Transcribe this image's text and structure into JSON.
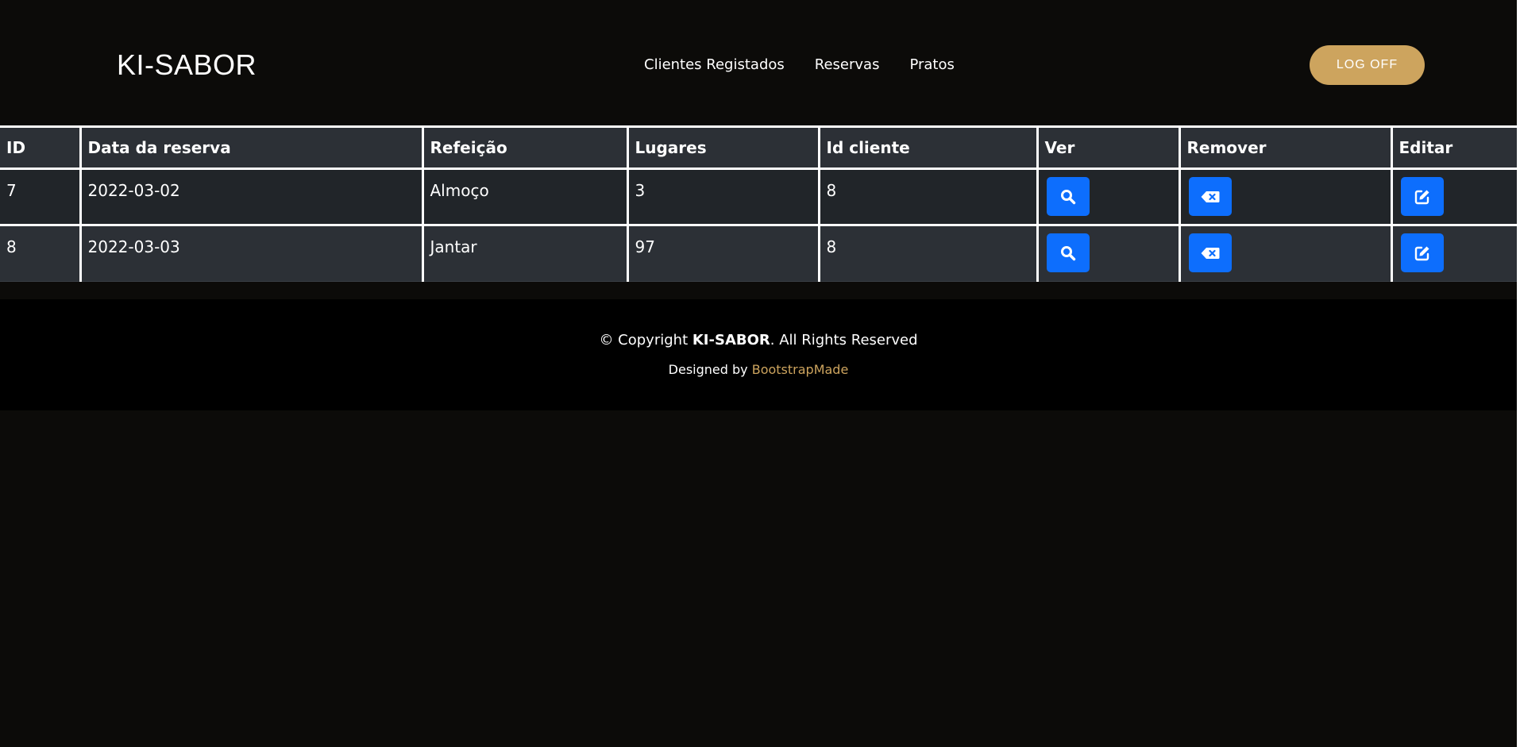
{
  "header": {
    "logo": "KI-SABOR",
    "nav": [
      "Clientes Registados",
      "Reservas",
      "Pratos"
    ],
    "logoff_label": "LOG OFF"
  },
  "table": {
    "columns": [
      "ID",
      "Data da reserva",
      "Refeição",
      "Lugares",
      "Id cliente",
      "Ver",
      "Remover",
      "Editar"
    ],
    "rows": [
      {
        "id": "7",
        "date": "2022-03-02",
        "meal": "Almoço",
        "seats": "3",
        "client": "8"
      },
      {
        "id": "8",
        "date": "2022-03-03",
        "meal": "Jantar",
        "seats": "97",
        "client": "8"
      }
    ],
    "actions": {
      "view_icon": "search-icon",
      "remove_icon": "backspace-icon",
      "edit_icon": "edit-icon"
    }
  },
  "footer": {
    "copyright_prefix": "© Copyright ",
    "brand": "KI-SABOR",
    "copyright_suffix": ". All Rights Reserved",
    "designed_by": "Designed by ",
    "designer_link": "BootstrapMade"
  },
  "colors": {
    "accent": "#cda45e",
    "button_primary": "#0d6efd",
    "background": "#0c0b09",
    "footer_background": "#000000"
  }
}
